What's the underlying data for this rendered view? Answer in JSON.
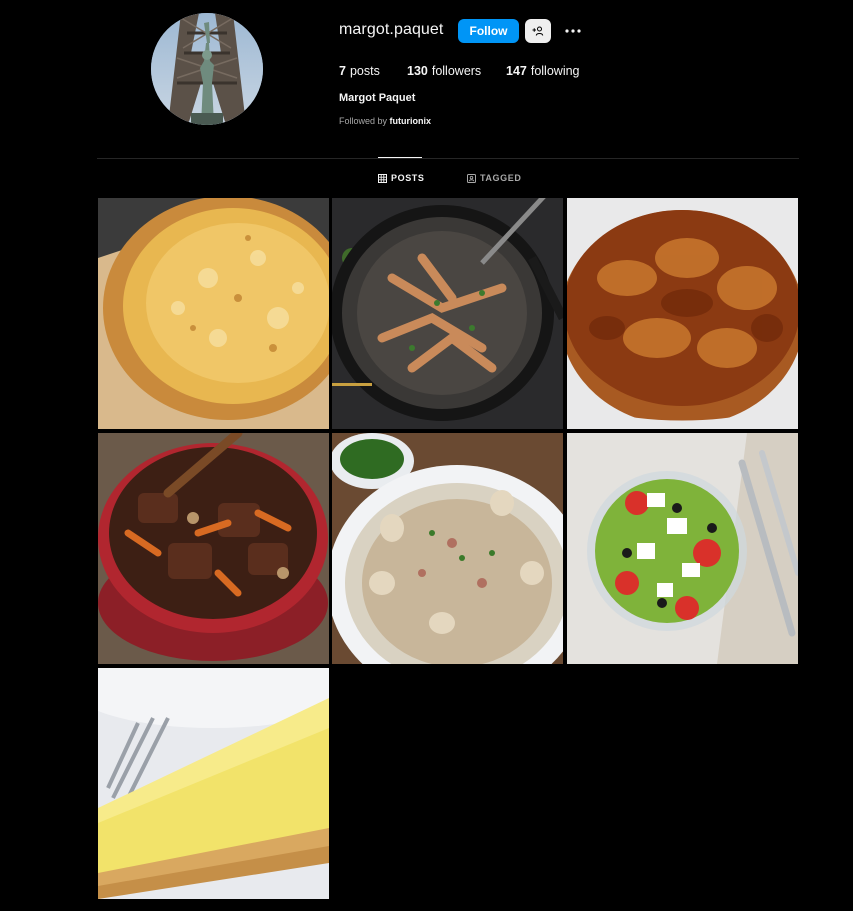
{
  "profile": {
    "username": "margot.paquet",
    "full_name": "Margot Paquet",
    "follow_label": "Follow",
    "avatar_icon": "profile-photo",
    "suggest_icon": "add-user-icon",
    "more_icon": "more-options-icon"
  },
  "stats": {
    "posts_count": "7",
    "posts_label": "posts",
    "followers_count": "130",
    "followers_label": "followers",
    "following_count": "147",
    "following_label": "following"
  },
  "followed_by": {
    "prefix": "Followed by",
    "user": "futurionix"
  },
  "tabs": [
    {
      "label": "POSTS",
      "icon": "grid-icon",
      "active": true
    },
    {
      "label": "TAGGED",
      "icon": "tagged-icon",
      "active": false
    }
  ],
  "posts": [
    {
      "name": "cheese-pizza"
    },
    {
      "name": "frog-legs-pan"
    },
    {
      "name": "tarte-tatin"
    },
    {
      "name": "beef-stew-pot"
    },
    {
      "name": "creamy-chicken-mushrooms"
    },
    {
      "name": "greek-salad"
    },
    {
      "name": "lemon-tart-slice"
    }
  ],
  "colors": {
    "background": "#000000",
    "accent": "#0095f6",
    "text": "#f5f5f5",
    "muted": "#a8a8a8",
    "divider": "#262626"
  }
}
